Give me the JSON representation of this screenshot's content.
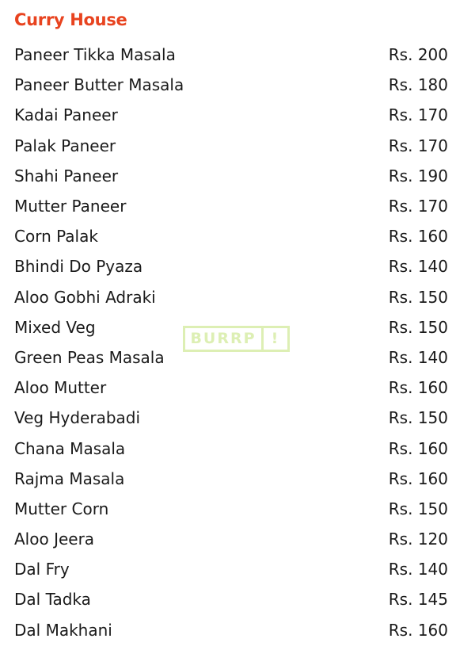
{
  "section": {
    "title": "Curry House"
  },
  "items": [
    {
      "name": "Paneer Tikka Masala",
      "price": "Rs. 200"
    },
    {
      "name": "Paneer Butter Masala",
      "price": "Rs. 180"
    },
    {
      "name": "Kadai Paneer",
      "price": "Rs. 170"
    },
    {
      "name": "Palak Paneer",
      "price": "Rs. 170"
    },
    {
      "name": "Shahi Paneer",
      "price": "Rs. 190"
    },
    {
      "name": "Mutter Paneer",
      "price": "Rs. 170"
    },
    {
      "name": "Corn Palak",
      "price": "Rs. 160"
    },
    {
      "name": "Bhindi Do Pyaza",
      "price": "Rs. 140"
    },
    {
      "name": "Aloo Gobhi Adraki",
      "price": "Rs. 150"
    },
    {
      "name": "Mixed Veg",
      "price": "Rs. 150"
    },
    {
      "name": "Green Peas Masala",
      "price": "Rs. 140"
    },
    {
      "name": "Aloo Mutter",
      "price": "Rs. 160"
    },
    {
      "name": "Veg Hyderabadi",
      "price": "Rs. 150"
    },
    {
      "name": "Chana Masala",
      "price": "Rs. 160"
    },
    {
      "name": "Rajma Masala",
      "price": "Rs. 160"
    },
    {
      "name": "Mutter Corn",
      "price": "Rs. 150"
    },
    {
      "name": "Aloo Jeera",
      "price": "Rs. 120"
    },
    {
      "name": "Dal Fry",
      "price": "Rs. 140"
    },
    {
      "name": "Dal Tadka",
      "price": "Rs. 145"
    },
    {
      "name": "Dal Makhani",
      "price": "Rs. 160"
    }
  ],
  "watermark": {
    "word": "BURRP",
    "bang": "!"
  },
  "colors": {
    "title": "#e8431f",
    "text": "#1a1a1a",
    "watermark": "#dcefb0"
  }
}
